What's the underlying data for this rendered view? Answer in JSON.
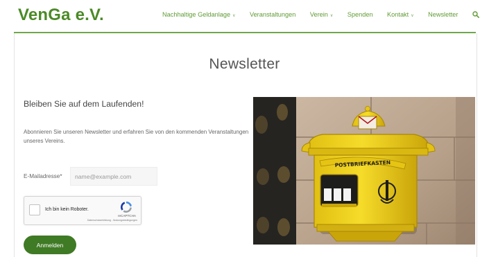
{
  "site": {
    "logo": "VenGa e.V."
  },
  "nav": {
    "items": [
      {
        "label": "Nachhaltige Geldanlage",
        "has_dropdown": true
      },
      {
        "label": "Veranstaltungen",
        "has_dropdown": false
      },
      {
        "label": "Verein",
        "has_dropdown": true
      },
      {
        "label": "Spenden",
        "has_dropdown": false
      },
      {
        "label": "Kontakt",
        "has_dropdown": true
      },
      {
        "label": "Newsletter",
        "has_dropdown": false
      }
    ],
    "search_icon": "search-icon",
    "dropdown_icon": "chevron-down-icon"
  },
  "page": {
    "title": "Newsletter",
    "subheading": "Bleiben Sie auf dem Laufenden!",
    "intro": "Abonnieren Sie unseren Newsletter und erfahren Sie von den kommenden Veranstaltungen unseres Vereins."
  },
  "form": {
    "email_label": "E-Mailadresse*",
    "email_placeholder": "name@example.com",
    "email_value": "",
    "captcha_label": "Ich bin kein Roboter.",
    "captcha_brand": "reCAPTCHA",
    "captcha_links": "Datenschutzerklärung - Nutzungsbedingungen",
    "captcha_checked": false,
    "submit_label": "Anmelden"
  },
  "image": {
    "sign_text": "POSTBRIEFKASTEN"
  },
  "colors": {
    "brand_green": "#4b8a26",
    "nav_green": "#5f9b34",
    "button_green": "#3f7a24",
    "mailbox_yellow": "#f2d21b"
  }
}
